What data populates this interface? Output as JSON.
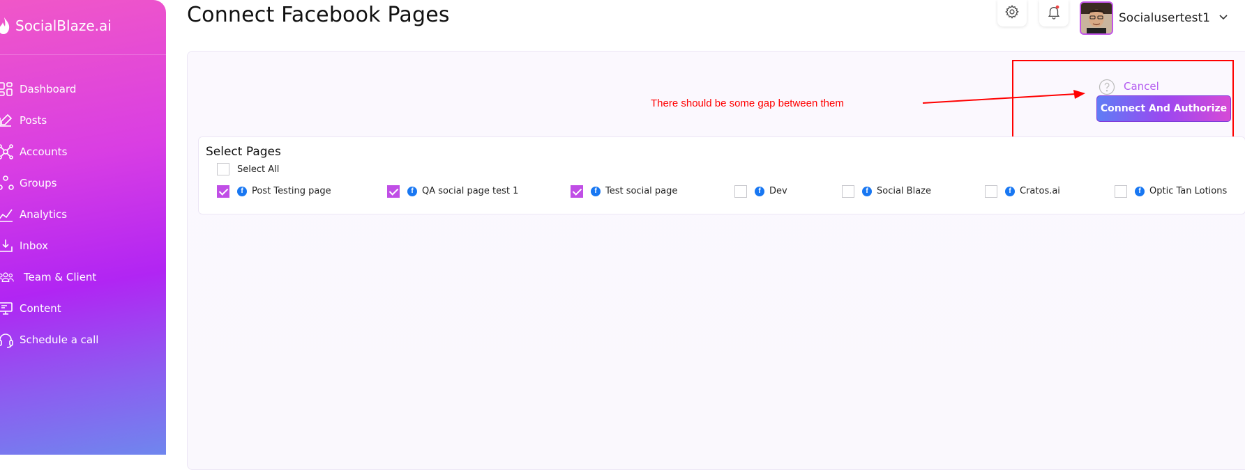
{
  "sidebar": {
    "brand": "SocialBlaze.ai",
    "items": [
      {
        "label": "Dashboard",
        "icon": "dashboard-icon"
      },
      {
        "label": "Posts",
        "icon": "edit-icon"
      },
      {
        "label": "Accounts",
        "icon": "network-icon"
      },
      {
        "label": "Groups",
        "icon": "groups-icon"
      },
      {
        "label": "Analytics",
        "icon": "chart-icon"
      },
      {
        "label": "Inbox",
        "icon": "inbox-icon"
      },
      {
        "label": "Team & Client",
        "icon": "team-icon"
      },
      {
        "label": "Content",
        "icon": "content-icon"
      },
      {
        "label": "Schedule a call",
        "icon": "headset-icon"
      }
    ]
  },
  "header": {
    "title": "Connect Facebook Pages",
    "username": "Socialusertest1"
  },
  "actions": {
    "cancel_label": "Cancel",
    "connect_label": "Connect And Authorize"
  },
  "annotation": {
    "text": "There should be some gap between them",
    "color": "#ff0000"
  },
  "select_pages": {
    "title": "Select Pages",
    "select_all_label": "Select All",
    "select_all_checked": false,
    "pages": [
      {
        "name": "Post Testing page",
        "checked": true
      },
      {
        "name": "QA social page test 1",
        "checked": true
      },
      {
        "name": "Test social page",
        "checked": true
      },
      {
        "name": "Dev",
        "checked": false
      },
      {
        "name": "Social Blaze",
        "checked": false
      },
      {
        "name": "Cratos.ai",
        "checked": false
      },
      {
        "name": "Optic Tan Lotions",
        "checked": false
      }
    ]
  },
  "colors": {
    "accent": "#c04ee6",
    "facebook": "#1877f2"
  }
}
